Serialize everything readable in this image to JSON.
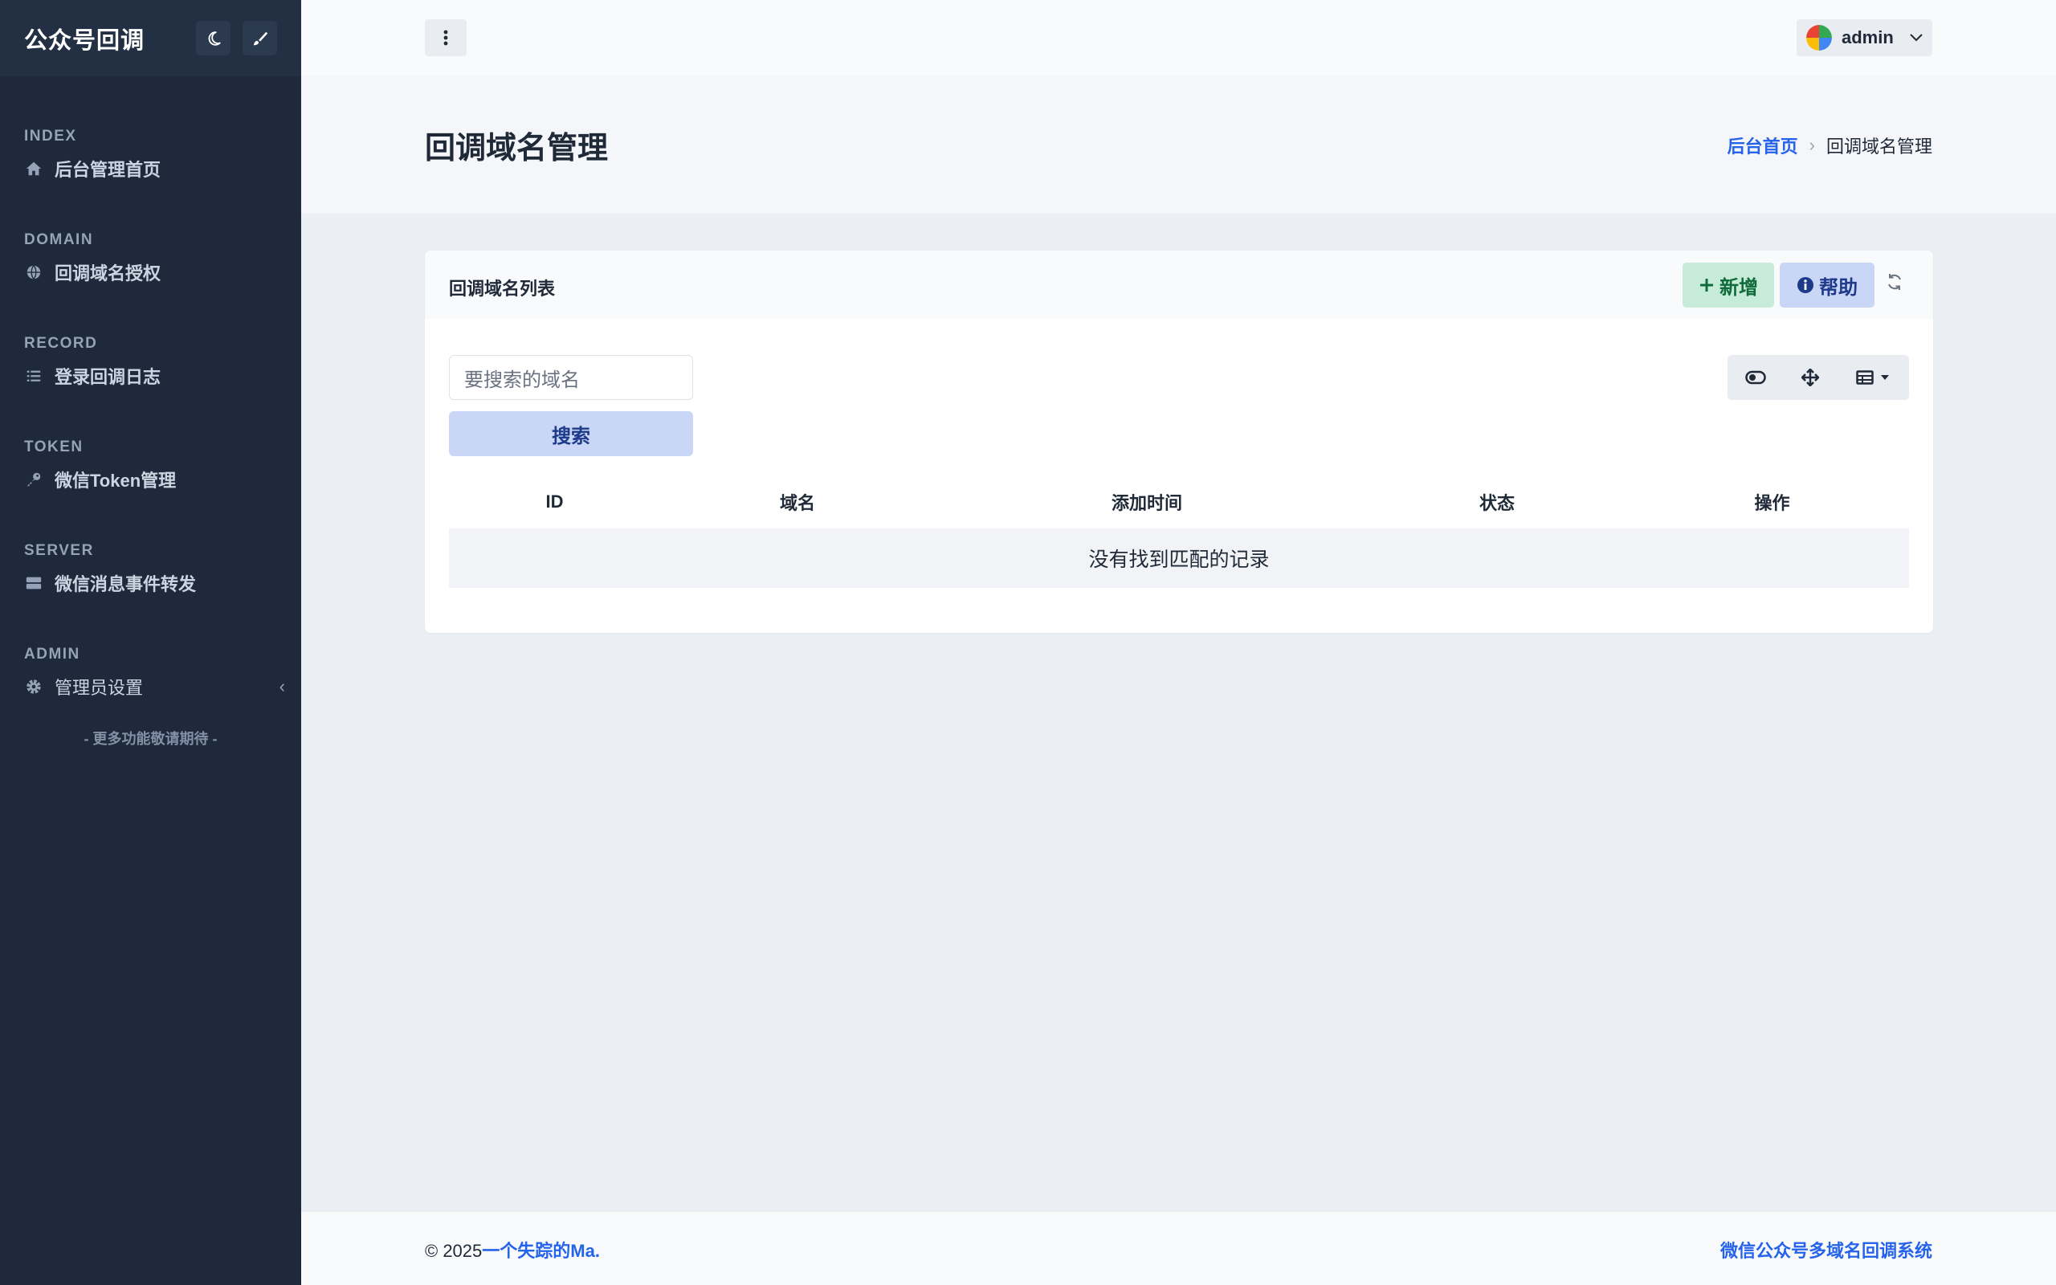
{
  "sidebar": {
    "brand": "公众号回调",
    "sections": [
      {
        "heading": "INDEX",
        "label": "后台管理首页",
        "icon": "home-icon"
      },
      {
        "heading": "DOMAIN",
        "label": "回调域名授权",
        "icon": "globe-icon"
      },
      {
        "heading": "RECORD",
        "label": "登录回调日志",
        "icon": "list-icon"
      },
      {
        "heading": "TOKEN",
        "label": "微信Token管理",
        "icon": "key-icon"
      },
      {
        "heading": "SERVER",
        "label": "微信消息事件转发",
        "icon": "server-icon"
      },
      {
        "heading": "ADMIN",
        "label": "管理员设置",
        "icon": "gear-icon"
      }
    ],
    "more_text": "- 更多功能敬请期待 -"
  },
  "topbar": {
    "user_name": "admin"
  },
  "page": {
    "title": "回调域名管理",
    "breadcrumb_home": "后台首页",
    "breadcrumb_current": "回调域名管理"
  },
  "card": {
    "title": "回调域名列表",
    "add_label": "新增",
    "help_label": "帮助",
    "search_placeholder": "要搜索的域名",
    "search_button": "搜索",
    "columns": [
      "ID",
      "域名",
      "添加时间",
      "状态",
      "操作"
    ],
    "empty_text": "没有找到匹配的记录"
  },
  "footer": {
    "copyright_prefix": "© 2025",
    "author": "一个失踪的Ma.",
    "system_name": "微信公众号多域名回调系统"
  },
  "colors": {
    "sidebar_bg": "#1e293b",
    "accent": "#2563eb",
    "success_bg": "#c7ebd9",
    "info_bg": "#c9d6f5"
  }
}
